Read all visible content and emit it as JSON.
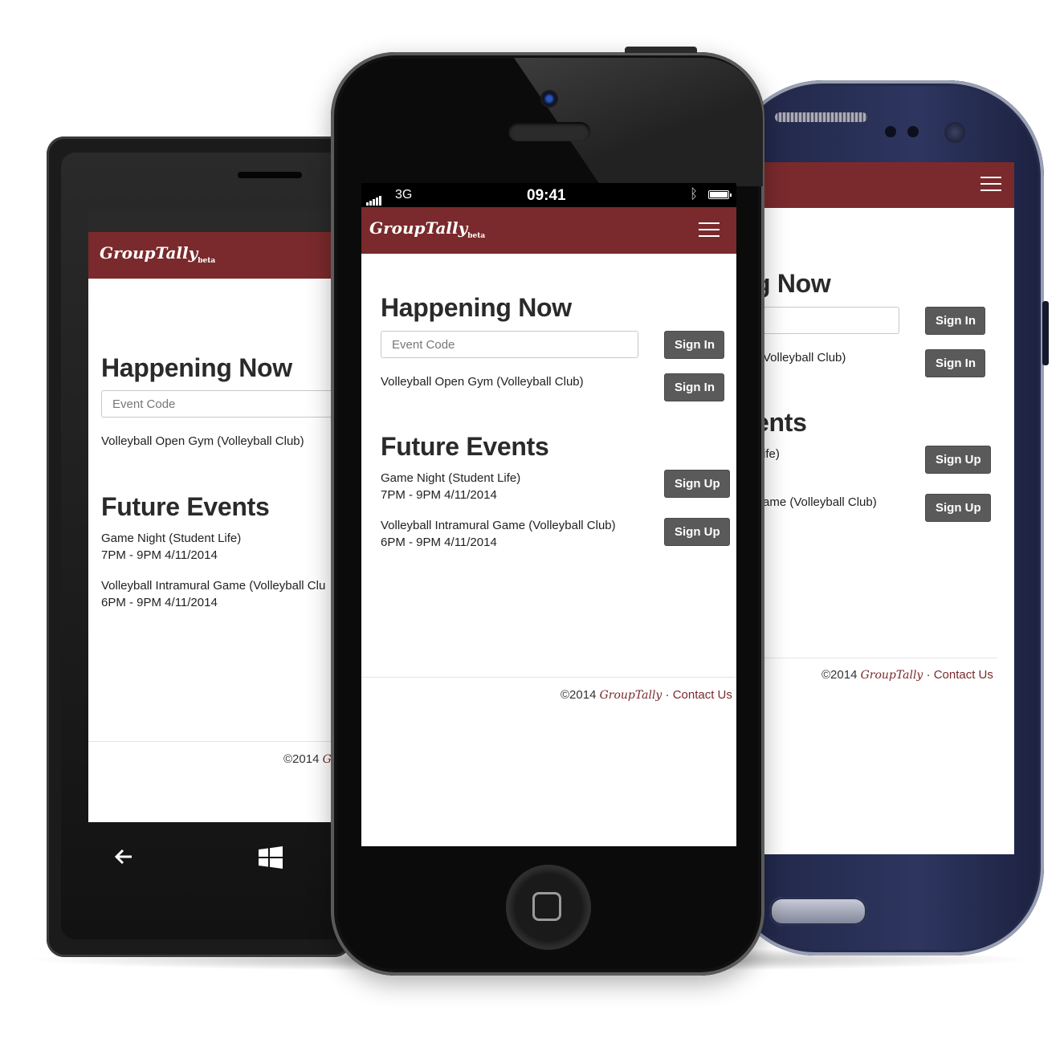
{
  "app": {
    "brand": "GroupTally",
    "brand_suffix": "beta",
    "accent": "#7a2a2c"
  },
  "status_bar": {
    "network": "3G",
    "time": "09:41"
  },
  "happening_now": {
    "heading": "Happening Now",
    "event_code_placeholder": "Event Code",
    "sign_in_label": "Sign In",
    "events": [
      {
        "name": "Volleyball Open Gym (Volleyball Club)",
        "action": "Sign In"
      }
    ]
  },
  "future_events": {
    "heading": "Future Events",
    "events": [
      {
        "name": "Game Night (Student Life)",
        "time": "7PM - 9PM 4/11/2014",
        "action": "Sign Up"
      },
      {
        "name": "Volleyball Intramural Game (Volleyball Club)",
        "time": "6PM - 9PM 4/11/2014",
        "action": "Sign Up"
      }
    ]
  },
  "footer": {
    "copyright": "©2014",
    "brand": "GroupTally",
    "separator": "·",
    "contact": "Contact Us"
  },
  "partial": {
    "right_heading_now": "g Now",
    "right_heading_events": "ents",
    "right_event1": "Volleyball Club)",
    "right_event2": "ife)",
    "right_event3": "ame (Volleyball Club)",
    "left_event3": "Volleyball Intramural Game (Volleyball Clu",
    "left_footer_brand": "G"
  },
  "icons": {
    "menu": "hamburger-icon",
    "back": "back-arrow-icon",
    "windows": "windows-logo-icon",
    "bluetooth": "bluetooth-icon",
    "battery": "battery-icon",
    "signal": "signal-icon"
  }
}
